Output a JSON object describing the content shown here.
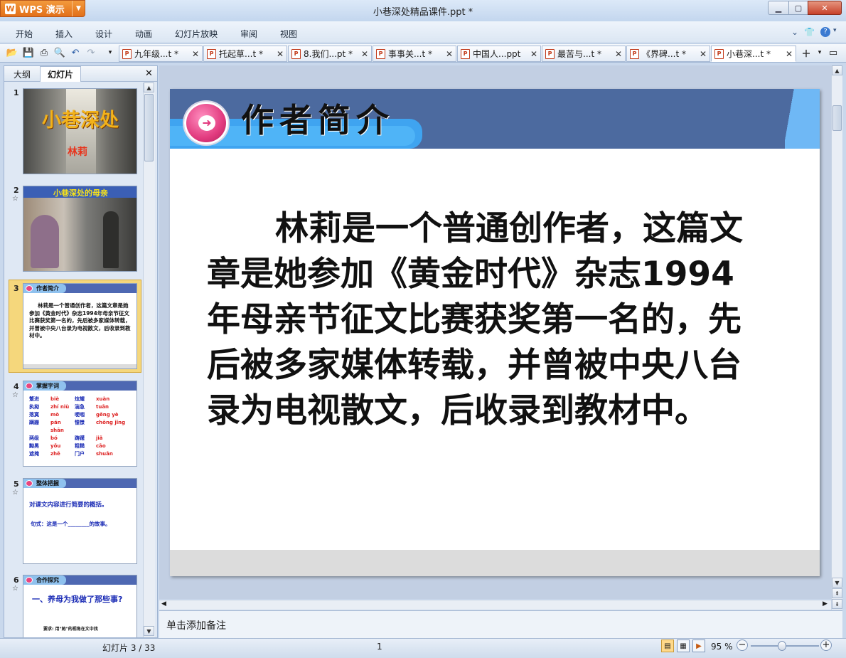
{
  "app": {
    "menu_button": "WPS 演示",
    "window_title": "小巷深处精品课件.ppt *"
  },
  "menu": [
    "开始",
    "插入",
    "设计",
    "动画",
    "幻灯片放映",
    "审阅",
    "视图"
  ],
  "doc_tabs": [
    {
      "label": "九年级...t *"
    },
    {
      "label": "托起草...t *"
    },
    {
      "label": "8.我们...pt *"
    },
    {
      "label": "事事关...t *"
    },
    {
      "label": "中国人...ppt"
    },
    {
      "label": "最苦与...t *"
    },
    {
      "label": "《界碑...t *"
    },
    {
      "label": "小巷深...t *"
    }
  ],
  "left_panel": {
    "tabs": [
      "大纲",
      "幻灯片"
    ],
    "thumbnails": [
      {
        "num": "1",
        "title": "小巷深处",
        "subtitle": "林莉"
      },
      {
        "num": "2",
        "title": "小巷深处的母亲"
      },
      {
        "num": "3",
        "title": "作者简介",
        "body": "林莉是一个普通创作者，这篇文章是她参加《黄金时代》杂志1994年母亲节征文比赛获奖第一名的，先后被多家媒体转载，并曾被中央八台录为电视散文，后收录到教材中。"
      },
      {
        "num": "4",
        "title": "掌握字词",
        "words": [
          [
            "蹩进",
            "biè",
            "炫耀",
            "xuàn"
          ],
          [
            "执拗",
            "zhí niù",
            "湍急",
            "tuān"
          ],
          [
            "落寞",
            "mò",
            "哽咽",
            "gěng yè"
          ],
          [
            "蹒跚",
            "pán shān",
            "憧憬",
            "chōng jǐng"
          ],
          [
            "两级",
            "bó",
            "踌躇",
            "jiǎ"
          ],
          [
            "黝黑",
            "yǒu",
            "粗糙",
            "cāo"
          ],
          [
            "遮掩",
            "zhē",
            "门户",
            "shuān"
          ]
        ]
      },
      {
        "num": "5",
        "title": "整体把握",
        "line1": "对课文内容进行简要的概括。",
        "line2": "句式：这是一个________的故事。"
      },
      {
        "num": "6",
        "title": "合作探究",
        "line1": "一、养母为我做了那些事?",
        "line2": "要求: 用\"她\"的视角在文中找"
      }
    ]
  },
  "slide": {
    "title": "作者简介",
    "body": "林莉是一个普通创作者，这篇文章是她参加《黄金时代》杂志1994年母亲节征文比赛获奖第一名的，先后被多家媒体转载，并曾被中央八台录为电视散文，后收录到教材中。"
  },
  "notes_placeholder": "单击添加备注",
  "status": {
    "slide_counter": "幻灯片 3 / 33",
    "page_num": "1",
    "zoom": "95 %"
  },
  "colors": {
    "title_bar": "#c3d6ee",
    "wps_orange": "#e2701a",
    "slide_header": "#4c6a9f",
    "slide_header_band": "#3fa4f0",
    "title_circle": "#e23b7f",
    "selected_thumb": "#f5d77c"
  }
}
